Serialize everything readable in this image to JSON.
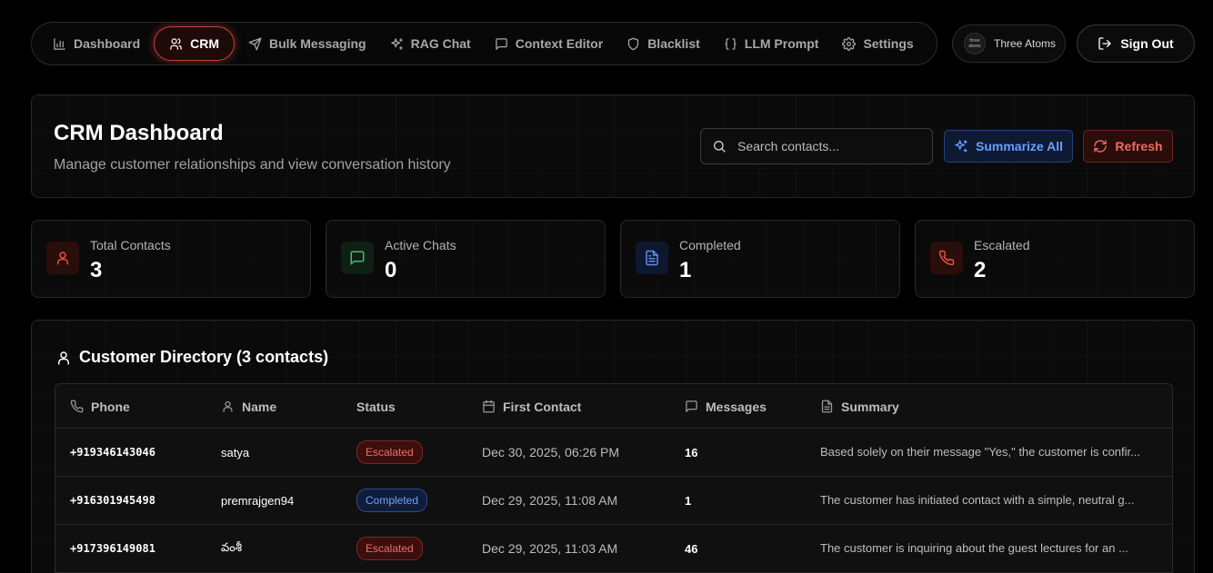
{
  "nav": {
    "items": [
      {
        "label": "Dashboard",
        "icon": "bar-chart-icon"
      },
      {
        "label": "CRM",
        "icon": "users-icon",
        "active": true
      },
      {
        "label": "Bulk Messaging",
        "icon": "send-icon"
      },
      {
        "label": "RAG Chat",
        "icon": "sparkles-icon"
      },
      {
        "label": "Context Editor",
        "icon": "message-square-icon"
      },
      {
        "label": "Blacklist",
        "icon": "shield-icon"
      },
      {
        "label": "LLM Prompt",
        "icon": "braces-icon"
      },
      {
        "label": "Settings",
        "icon": "gear-icon"
      }
    ],
    "org_name": "Three Atoms",
    "org_logo_text": "three atoms",
    "signout_label": "Sign Out"
  },
  "header": {
    "title": "CRM Dashboard",
    "subtitle": "Manage customer relationships and view conversation history",
    "search_placeholder": "Search contacts...",
    "summarize_label": "Summarize All",
    "refresh_label": "Refresh"
  },
  "stats": [
    {
      "label": "Total Contacts",
      "value": "3",
      "icon": "user-icon",
      "color": "#e5533d",
      "bg": "#2a0e0b"
    },
    {
      "label": "Active Chats",
      "value": "0",
      "icon": "message-square-icon",
      "color": "#3fbf6a",
      "bg": "#0f1f14"
    },
    {
      "label": "Completed",
      "value": "1",
      "icon": "file-text-icon",
      "color": "#5b8ef0",
      "bg": "#0e1730"
    },
    {
      "label": "Escalated",
      "value": "2",
      "icon": "phone-icon",
      "color": "#e5533d",
      "bg": "#2a0e0b"
    }
  ],
  "directory": {
    "title": "Customer Directory (3 contacts)",
    "columns": {
      "phone": "Phone",
      "name": "Name",
      "status": "Status",
      "first_contact": "First Contact",
      "messages": "Messages",
      "summary": "Summary"
    },
    "rows": [
      {
        "phone": "+919346143046",
        "name": "satya",
        "status": "Escalated",
        "first_contact": "Dec 30, 2025, 06:26 PM",
        "messages": "16",
        "summary": "Based solely on their message \"Yes,\" the customer is confir..."
      },
      {
        "phone": "+916301945498",
        "name": "premrajgen94",
        "status": "Completed",
        "first_contact": "Dec 29, 2025, 11:08 AM",
        "messages": "1",
        "summary": "The customer has initiated contact with a simple, neutral g..."
      },
      {
        "phone": "+917396149081",
        "name": "వంశీ",
        "status": "Escalated",
        "first_contact": "Dec 29, 2025, 11:03 AM",
        "messages": "46",
        "summary": "The customer is inquiring about the guest lectures for an ..."
      }
    ]
  },
  "colors": {
    "accent_red": "#c2413a",
    "accent_blue": "#66a0ff",
    "background": "#000000"
  }
}
